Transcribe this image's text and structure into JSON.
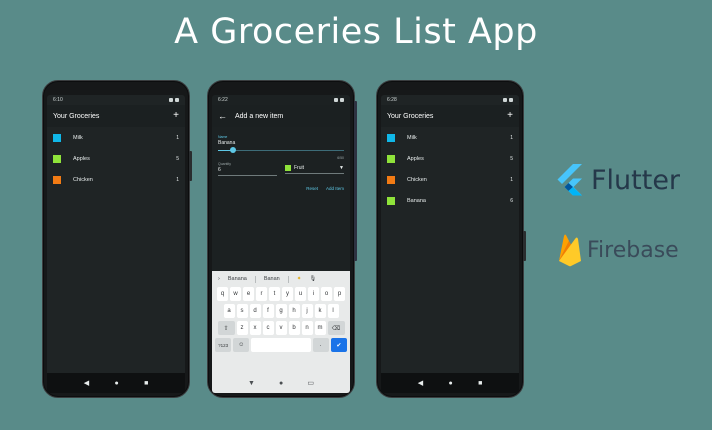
{
  "title": "A Groceries List App",
  "phones": [
    {
      "status_time": "6:10",
      "appbar_title": "Your Groceries",
      "items": [
        {
          "name": "Milk",
          "qty": "1",
          "color": "#10b7e8"
        },
        {
          "name": "Apples",
          "qty": "5",
          "color": "#8fe33a"
        },
        {
          "name": "Chicken",
          "qty": "1",
          "color": "#f27b14"
        }
      ]
    },
    {
      "status_time": "6:22",
      "appbar_title": "Add a new item",
      "form": {
        "name_label": "Name",
        "name_value": "Banana",
        "name_counter": "6/50",
        "name_fill_fraction": 0.12,
        "quantity_label": "Quantity",
        "quantity_value": "6",
        "category_value": "Fruit",
        "category_color": "#8fe33a",
        "reset_label": "Reset",
        "add_label": "Add Item"
      },
      "keyboard": {
        "suggestions": [
          "Banana",
          "Banan"
        ],
        "rows": [
          [
            "q",
            "w",
            "e",
            "r",
            "t",
            "y",
            "u",
            "i",
            "o",
            "p"
          ],
          [
            "a",
            "s",
            "d",
            "f",
            "g",
            "h",
            "j",
            "k",
            "l"
          ],
          [
            "z",
            "x",
            "c",
            "v",
            "b",
            "n",
            "m"
          ]
        ],
        "numbers_key": "?123"
      }
    },
    {
      "status_time": "6:28",
      "appbar_title": "Your Groceries",
      "items": [
        {
          "name": "Milk",
          "qty": "1",
          "color": "#10b7e8"
        },
        {
          "name": "Apples",
          "qty": "5",
          "color": "#8fe33a"
        },
        {
          "name": "Chicken",
          "qty": "1",
          "color": "#f27b14"
        },
        {
          "name": "Banana",
          "qty": "6",
          "color": "#8fe33a"
        }
      ]
    }
  ],
  "nav_icons": [
    "back-triangle",
    "home-circle",
    "overview-square"
  ],
  "brands": [
    {
      "name": "Flutter",
      "icon": "flutter-logo"
    },
    {
      "name": "Firebase",
      "icon": "firebase-logo"
    }
  ]
}
